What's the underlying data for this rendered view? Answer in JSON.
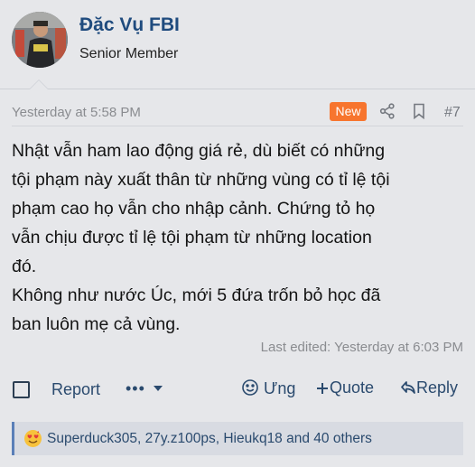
{
  "user": {
    "name": "Đặc Vụ FBI",
    "title": "Senior Member"
  },
  "post": {
    "date": "Yesterday at 5:58 PM",
    "badge": "New",
    "number": "#7",
    "lines": [
      "Nhật vẫn ham lao động giá rẻ, dù biết có những",
      "tội phạm này xuất thân từ những vùng có tỉ lệ tội",
      "phạm cao họ vẫn cho nhập cảnh. Chứng tỏ họ",
      "vẫn chịu được tỉ lệ tội phạm từ những location",
      "đó.",
      "Không như nước Úc, mới 5 đứa trốn bỏ học đã",
      "ban luôn mẹ cả vùng."
    ],
    "last_edited": "Last edited: Yesterday at 6:03 PM"
  },
  "actions": {
    "report": "Report",
    "more": "•••",
    "react": "Ưng",
    "quote": "Quote",
    "reply": "Reply"
  },
  "reactions": {
    "text": "Superduck305, 27y.z100ps, Hieukq18 and 40 others",
    "emoji": "love-face-icon"
  },
  "colors": {
    "background": "#e6e7ea",
    "username": "#1f4b7e",
    "badge": "#f7752e",
    "link": "#2a4a6e"
  }
}
